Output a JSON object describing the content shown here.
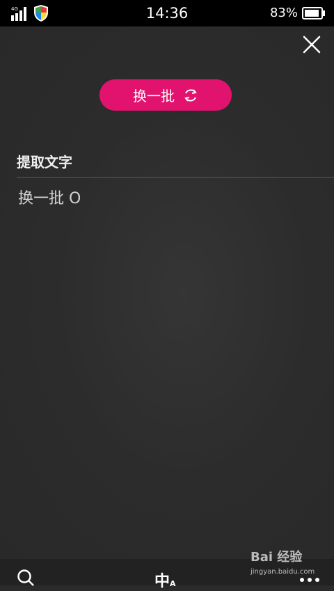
{
  "status_bar": {
    "network": "4G",
    "time": "14:36",
    "battery_percent": "83%"
  },
  "actions": {
    "refresh_label": "换一批"
  },
  "section": {
    "title": "提取文字",
    "extracted_text": "换一批 O"
  },
  "bottom_bar": {
    "lang_label": "中",
    "lang_sub": "A"
  },
  "watermark": {
    "brand": "Bai 经验",
    "url": "jingyan.baidu.com"
  },
  "colors": {
    "accent": "#e2136e",
    "background": "#2b2b2b"
  }
}
